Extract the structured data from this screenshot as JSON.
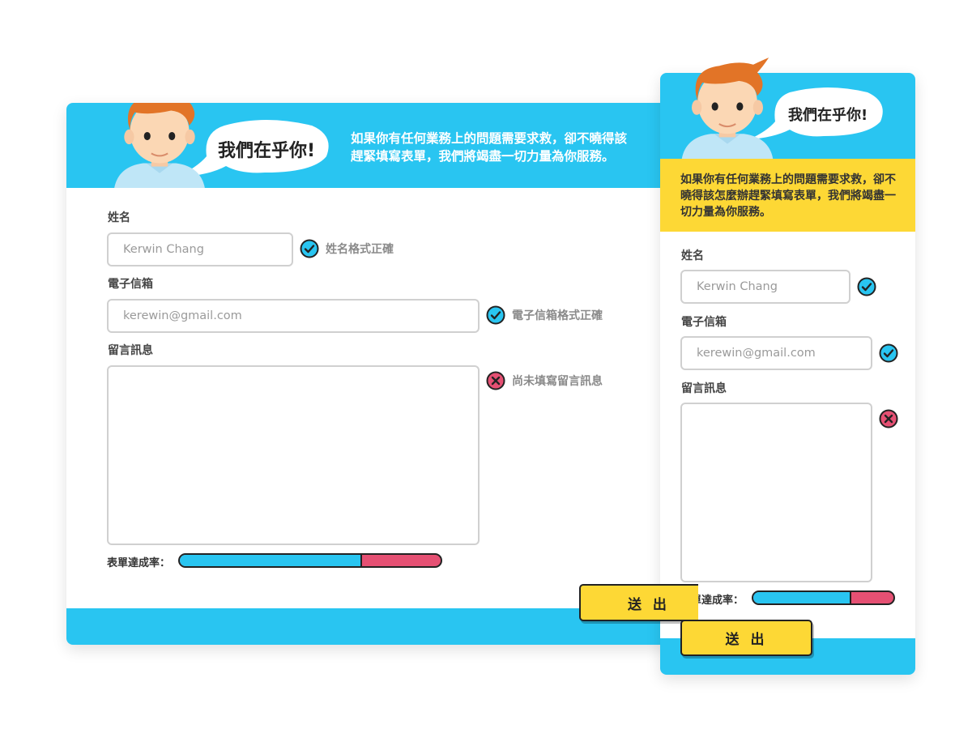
{
  "bubble_text": "我們在乎你!",
  "intro_line1": "如果你有任何業務上的問題需要求救，卻不曉得該",
  "intro_line2": "趕緊填寫表單，我們將竭盡一切力量為你服務。",
  "intro_mobile": "如果你有任何業務上的問題需要求救，卻不曉得該怎麼辦趕緊填寫表單，我們將竭盡一切力量為你服務。",
  "form": {
    "name_label": "姓名",
    "name_value": "Kerwin Chang",
    "name_status": "姓名格式正確",
    "email_label": "電子信箱",
    "email_value": "kerewin@gmail.com",
    "email_status": "電子信箱格式正確",
    "message_label": "留言訊息",
    "message_value": "",
    "message_status": "尚未填寫留言訊息",
    "progress_label": "表單達成率：",
    "desktop_progress_fraction": 0.7,
    "mobile_progress_fraction": 0.7,
    "submit_label_desktop": "送 出",
    "submit_label_mobile": "送 出"
  },
  "icons": {
    "valid": "check-circle-icon",
    "invalid": "x-circle-icon"
  },
  "colors": {
    "primary": "#29c5f1",
    "accent": "#fdd835",
    "error": "#e55073",
    "dark": "#222222"
  }
}
